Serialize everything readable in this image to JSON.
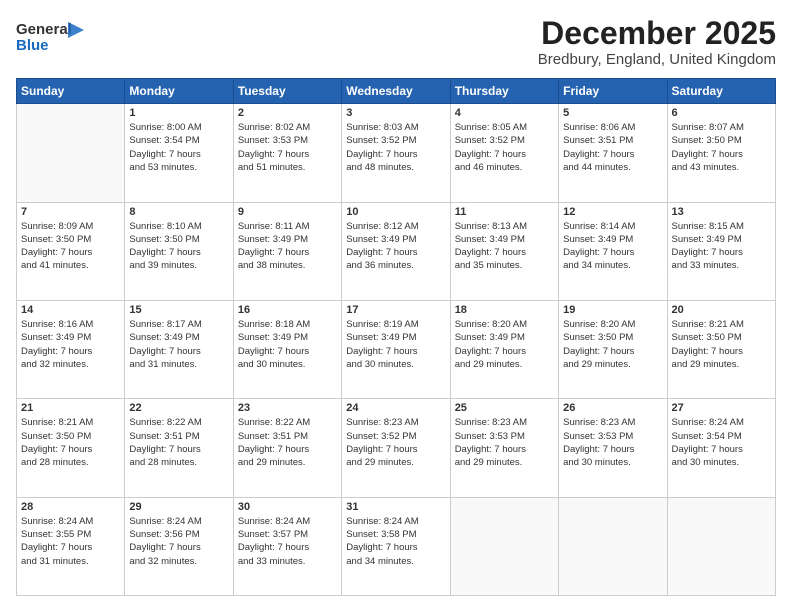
{
  "header": {
    "logo_general": "General",
    "logo_blue": "Blue",
    "month_title": "December 2025",
    "location": "Bredbury, England, United Kingdom"
  },
  "weekdays": [
    "Sunday",
    "Monday",
    "Tuesday",
    "Wednesday",
    "Thursday",
    "Friday",
    "Saturday"
  ],
  "weeks": [
    [
      {
        "day": "",
        "info": ""
      },
      {
        "day": "1",
        "info": "Sunrise: 8:00 AM\nSunset: 3:54 PM\nDaylight: 7 hours\nand 53 minutes."
      },
      {
        "day": "2",
        "info": "Sunrise: 8:02 AM\nSunset: 3:53 PM\nDaylight: 7 hours\nand 51 minutes."
      },
      {
        "day": "3",
        "info": "Sunrise: 8:03 AM\nSunset: 3:52 PM\nDaylight: 7 hours\nand 48 minutes."
      },
      {
        "day": "4",
        "info": "Sunrise: 8:05 AM\nSunset: 3:52 PM\nDaylight: 7 hours\nand 46 minutes."
      },
      {
        "day": "5",
        "info": "Sunrise: 8:06 AM\nSunset: 3:51 PM\nDaylight: 7 hours\nand 44 minutes."
      },
      {
        "day": "6",
        "info": "Sunrise: 8:07 AM\nSunset: 3:50 PM\nDaylight: 7 hours\nand 43 minutes."
      }
    ],
    [
      {
        "day": "7",
        "info": "Sunrise: 8:09 AM\nSunset: 3:50 PM\nDaylight: 7 hours\nand 41 minutes."
      },
      {
        "day": "8",
        "info": "Sunrise: 8:10 AM\nSunset: 3:50 PM\nDaylight: 7 hours\nand 39 minutes."
      },
      {
        "day": "9",
        "info": "Sunrise: 8:11 AM\nSunset: 3:49 PM\nDaylight: 7 hours\nand 38 minutes."
      },
      {
        "day": "10",
        "info": "Sunrise: 8:12 AM\nSunset: 3:49 PM\nDaylight: 7 hours\nand 36 minutes."
      },
      {
        "day": "11",
        "info": "Sunrise: 8:13 AM\nSunset: 3:49 PM\nDaylight: 7 hours\nand 35 minutes."
      },
      {
        "day": "12",
        "info": "Sunrise: 8:14 AM\nSunset: 3:49 PM\nDaylight: 7 hours\nand 34 minutes."
      },
      {
        "day": "13",
        "info": "Sunrise: 8:15 AM\nSunset: 3:49 PM\nDaylight: 7 hours\nand 33 minutes."
      }
    ],
    [
      {
        "day": "14",
        "info": "Sunrise: 8:16 AM\nSunset: 3:49 PM\nDaylight: 7 hours\nand 32 minutes."
      },
      {
        "day": "15",
        "info": "Sunrise: 8:17 AM\nSunset: 3:49 PM\nDaylight: 7 hours\nand 31 minutes."
      },
      {
        "day": "16",
        "info": "Sunrise: 8:18 AM\nSunset: 3:49 PM\nDaylight: 7 hours\nand 30 minutes."
      },
      {
        "day": "17",
        "info": "Sunrise: 8:19 AM\nSunset: 3:49 PM\nDaylight: 7 hours\nand 30 minutes."
      },
      {
        "day": "18",
        "info": "Sunrise: 8:20 AM\nSunset: 3:49 PM\nDaylight: 7 hours\nand 29 minutes."
      },
      {
        "day": "19",
        "info": "Sunrise: 8:20 AM\nSunset: 3:50 PM\nDaylight: 7 hours\nand 29 minutes."
      },
      {
        "day": "20",
        "info": "Sunrise: 8:21 AM\nSunset: 3:50 PM\nDaylight: 7 hours\nand 29 minutes."
      }
    ],
    [
      {
        "day": "21",
        "info": "Sunrise: 8:21 AM\nSunset: 3:50 PM\nDaylight: 7 hours\nand 28 minutes."
      },
      {
        "day": "22",
        "info": "Sunrise: 8:22 AM\nSunset: 3:51 PM\nDaylight: 7 hours\nand 28 minutes."
      },
      {
        "day": "23",
        "info": "Sunrise: 8:22 AM\nSunset: 3:51 PM\nDaylight: 7 hours\nand 29 minutes."
      },
      {
        "day": "24",
        "info": "Sunrise: 8:23 AM\nSunset: 3:52 PM\nDaylight: 7 hours\nand 29 minutes."
      },
      {
        "day": "25",
        "info": "Sunrise: 8:23 AM\nSunset: 3:53 PM\nDaylight: 7 hours\nand 29 minutes."
      },
      {
        "day": "26",
        "info": "Sunrise: 8:23 AM\nSunset: 3:53 PM\nDaylight: 7 hours\nand 30 minutes."
      },
      {
        "day": "27",
        "info": "Sunrise: 8:24 AM\nSunset: 3:54 PM\nDaylight: 7 hours\nand 30 minutes."
      }
    ],
    [
      {
        "day": "28",
        "info": "Sunrise: 8:24 AM\nSunset: 3:55 PM\nDaylight: 7 hours\nand 31 minutes."
      },
      {
        "day": "29",
        "info": "Sunrise: 8:24 AM\nSunset: 3:56 PM\nDaylight: 7 hours\nand 32 minutes."
      },
      {
        "day": "30",
        "info": "Sunrise: 8:24 AM\nSunset: 3:57 PM\nDaylight: 7 hours\nand 33 minutes."
      },
      {
        "day": "31",
        "info": "Sunrise: 8:24 AM\nSunset: 3:58 PM\nDaylight: 7 hours\nand 34 minutes."
      },
      {
        "day": "",
        "info": ""
      },
      {
        "day": "",
        "info": ""
      },
      {
        "day": "",
        "info": ""
      }
    ]
  ]
}
